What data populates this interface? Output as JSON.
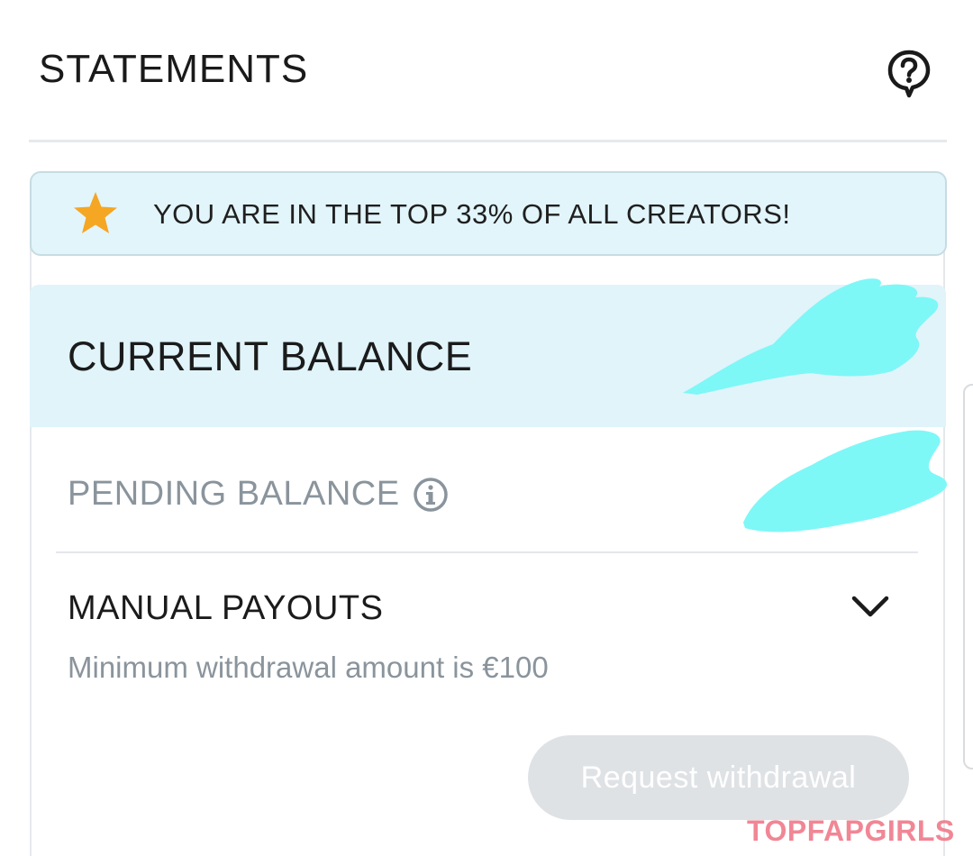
{
  "header": {
    "title": "STATEMENTS",
    "help_icon": "help-question-icon"
  },
  "rank_banner": {
    "icon": "star-icon",
    "text": "YOU ARE IN THE TOP 33% OF ALL CREATORS!",
    "star_color": "#f5a623"
  },
  "current_balance": {
    "label": "CURRENT BALANCE"
  },
  "pending_balance": {
    "label": "PENDING BALANCE",
    "icon": "info-icon"
  },
  "manual_payouts": {
    "label": "MANUAL PAYOUTS",
    "icon": "chevron-down-icon",
    "note": "Minimum withdrawal amount is €100",
    "button_label": "Request withdrawal"
  },
  "watermark": {
    "text": "TOPFAPGIRLS"
  },
  "colors": {
    "banner_bg": "#e2f5fb",
    "balance_bg": "#e0f4fa",
    "redaction": "#7ef7f7",
    "disabled_button": "#dfe2e5",
    "muted_text": "#8a949c"
  }
}
